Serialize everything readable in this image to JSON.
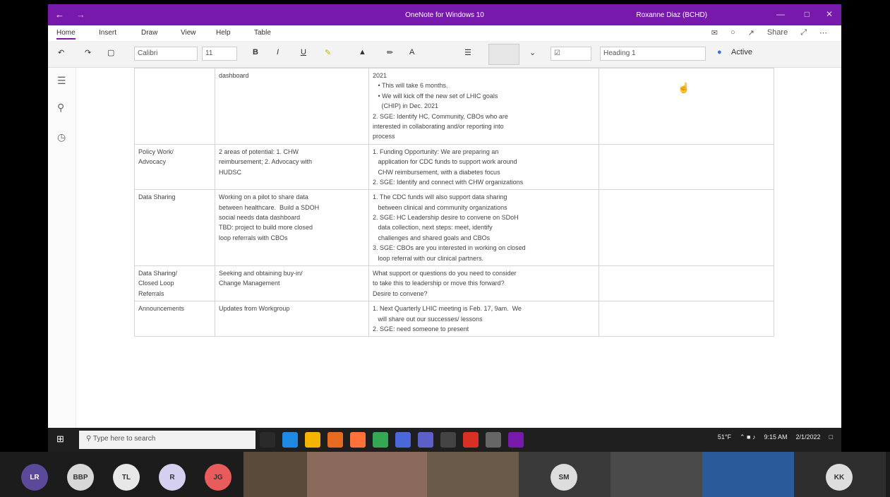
{
  "titlebar": {
    "title": "OneNote for Windows 10",
    "user": "Roxanne Diaz (BCHD)",
    "back": "←",
    "forward": "→",
    "minimize": "—",
    "maximize": "□",
    "close": "✕"
  },
  "menu": {
    "items": [
      "Home",
      "Insert",
      "Draw",
      "View",
      "Help",
      "Table"
    ],
    "share_label": "Share"
  },
  "ribbon": {
    "font_name": "Calibri",
    "font_size": "11",
    "bold": "B",
    "italic": "I",
    "underline": "U",
    "style": "Heading 1",
    "dictate": "Active",
    "undo": "↶",
    "redo": "↷"
  },
  "table": {
    "rows": [
      {
        "c1": [],
        "c2": [
          "dashboard"
        ],
        "c3": [
          "2021",
          "   • This will take 6 months.",
          "   • We will kick off the new set of LHIC goals",
          "     (CHIP) in Dec. 2021",
          "2. SGE: Identify HC, Community, CBOs who are",
          "interested in collaborating and/or reporting into",
          "process"
        ],
        "c4": []
      },
      {
        "c1": [
          "Policy Work/",
          "Advocacy"
        ],
        "c2": [
          "2 areas of potential: 1. CHW",
          "reimbursement; 2. Advocacy with",
          "HUDSC"
        ],
        "c3": [
          "1. Funding Opportunity: We are preparing an",
          "   application for CDC funds to support work around",
          "   CHW reimbursement, with a diabetes focus",
          "2. SGE: Identify and connect with CHW organizations"
        ],
        "c4": []
      },
      {
        "c1": [
          "Data Sharing"
        ],
        "c2": [
          "Working on a pilot to share data",
          "between healthcare.  Build a SDOH",
          "social needs data dashboard",
          "TBD: project to build more closed",
          "loop referrals with CBOs"
        ],
        "c3": [
          "1. The CDC funds will also support data sharing",
          "   between clinical and community organizations",
          "2. SGE: HC Leadership desire to convene on SDoH",
          "   data collection, next steps: meet, identify",
          "   challenges and shared goals and CBOs",
          "3. SGE: CBOs are you interested in working on closed",
          "   loop referral with our clinical partners."
        ],
        "c4": []
      },
      {
        "c1": [
          "Data Sharing/",
          "Closed Loop",
          "Referrals"
        ],
        "c2": [
          "Seeking and obtaining buy-in/",
          "Change Management"
        ],
        "c3": [
          "What support or questions do you need to consider",
          "to take this to leadership or move this forward?",
          "Desire to convene?"
        ],
        "c4": []
      },
      {
        "c1": [
          "Announcements"
        ],
        "c2": [
          "Updates from Workgroup"
        ],
        "c3": [
          "1. Next Quarterly LHIC meeting is Feb. 17, 9am.  We",
          "   will share out our successes/ lessons",
          "2. SGE: need someone to present"
        ],
        "c4": []
      }
    ]
  },
  "taskbar": {
    "search_placeholder": "Type here to search",
    "weather": "51°F",
    "time": "9:15 AM",
    "date": "2/1/2022"
  },
  "participants": {
    "avatars": [
      "LR",
      "BBP",
      "TL",
      "R",
      "JG"
    ],
    "avatar_colors": [
      "#5b4a9a",
      "#d8d8d8",
      "#e8e8e8",
      "#d6d0f0",
      "#e85c5c"
    ],
    "tile_avatars": [
      "SM",
      "KK"
    ]
  },
  "colors": {
    "titlebar": "#7719aa",
    "taskbar": "#1f1f1f"
  }
}
